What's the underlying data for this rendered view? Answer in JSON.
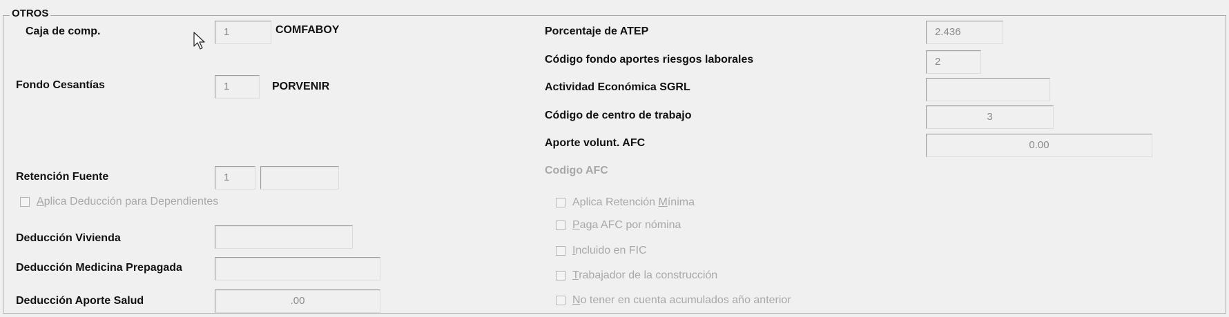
{
  "group": {
    "title": "OTROS"
  },
  "left": {
    "caja": {
      "label": "Caja de comp.",
      "code": "1",
      "name": "COMFABOY"
    },
    "cesantias": {
      "label": "Fondo Cesantías",
      "code": "1",
      "name": "PORVENIR"
    },
    "retencion": {
      "label": "Retención Fuente",
      "code": "1",
      "extra": ""
    },
    "dependientes": {
      "first": "A",
      "rest": "plica Deducción para Dependientes",
      "checked": false
    },
    "vivienda": {
      "label": "Deducción Vivienda",
      "value": ""
    },
    "medicina": {
      "label": "Deducción Medicina Prepagada",
      "value": ""
    },
    "salud": {
      "label": "Deducción Aporte Salud",
      "value": ".00"
    }
  },
  "right": {
    "atep": {
      "label": "Porcentaje de ATEP",
      "value": "2.436"
    },
    "fondo_riesgos": {
      "label": "Código fondo aportes riesgos laborales",
      "value": "2"
    },
    "actividad": {
      "label": "Actividad Económica SGRL",
      "value": ""
    },
    "centro": {
      "label": "Código de centro de trabajo",
      "value": "3"
    },
    "afc": {
      "label": "Aporte volunt. AFC",
      "value": "0.00"
    },
    "codigo_afc": {
      "label": "Codigo AFC"
    }
  },
  "checkboxes": [
    {
      "pre": "Aplica Retención ",
      "u": "M",
      "post": "ínima",
      "checked": false
    },
    {
      "pre": "",
      "u": "P",
      "post": "aga AFC por nómina",
      "checked": false
    },
    {
      "pre": "",
      "u": "I",
      "post": "ncluido en FIC",
      "checked": false
    },
    {
      "pre": "",
      "u": "T",
      "post": "rabajador de la construcción",
      "checked": false
    },
    {
      "pre": "",
      "u": "N",
      "post": "o tener en cuenta acumulados año anterior",
      "checked": false
    }
  ]
}
